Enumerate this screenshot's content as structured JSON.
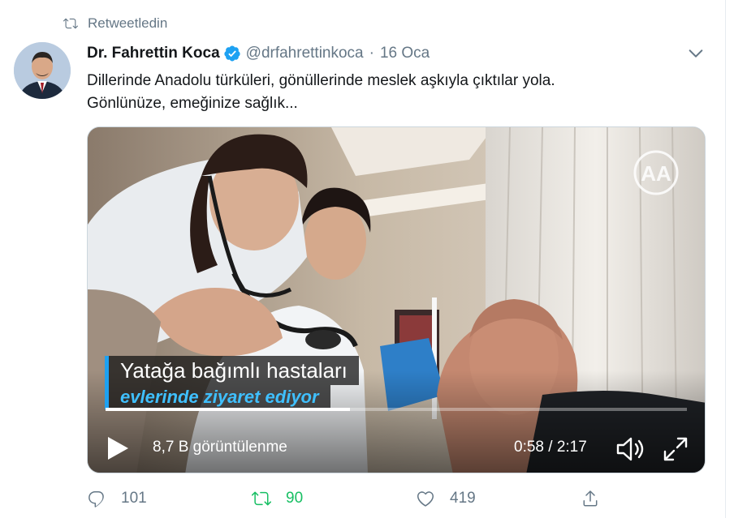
{
  "retweet_context": {
    "label": "Retweetledin"
  },
  "tweet": {
    "author_name": "Dr. Fahrettin Koca",
    "handle": "@drfahrettinkoca",
    "separator": "·",
    "date": "16 Oca",
    "text_lines": [
      "Dillerinde Anadolu türküleri, gönüllerinde meslek aşkıyla çıktılar yola.",
      "Gönlünüze, emeğinize sağlık..."
    ]
  },
  "video": {
    "caption_line1": "Yatağa bağımlı hastaları",
    "caption_line2": "evlerinde ziyaret ediyor",
    "watermark": "AA",
    "views": "8,7 B görüntülenme",
    "time": "0:58 / 2:17",
    "progress_fraction": 0.42
  },
  "actions": {
    "reply_count": "101",
    "retweet_count": "90",
    "like_count": "419"
  },
  "colors": {
    "accent": "#1da1f2",
    "retweet_active": "#17bf63",
    "muted": "#657786"
  }
}
